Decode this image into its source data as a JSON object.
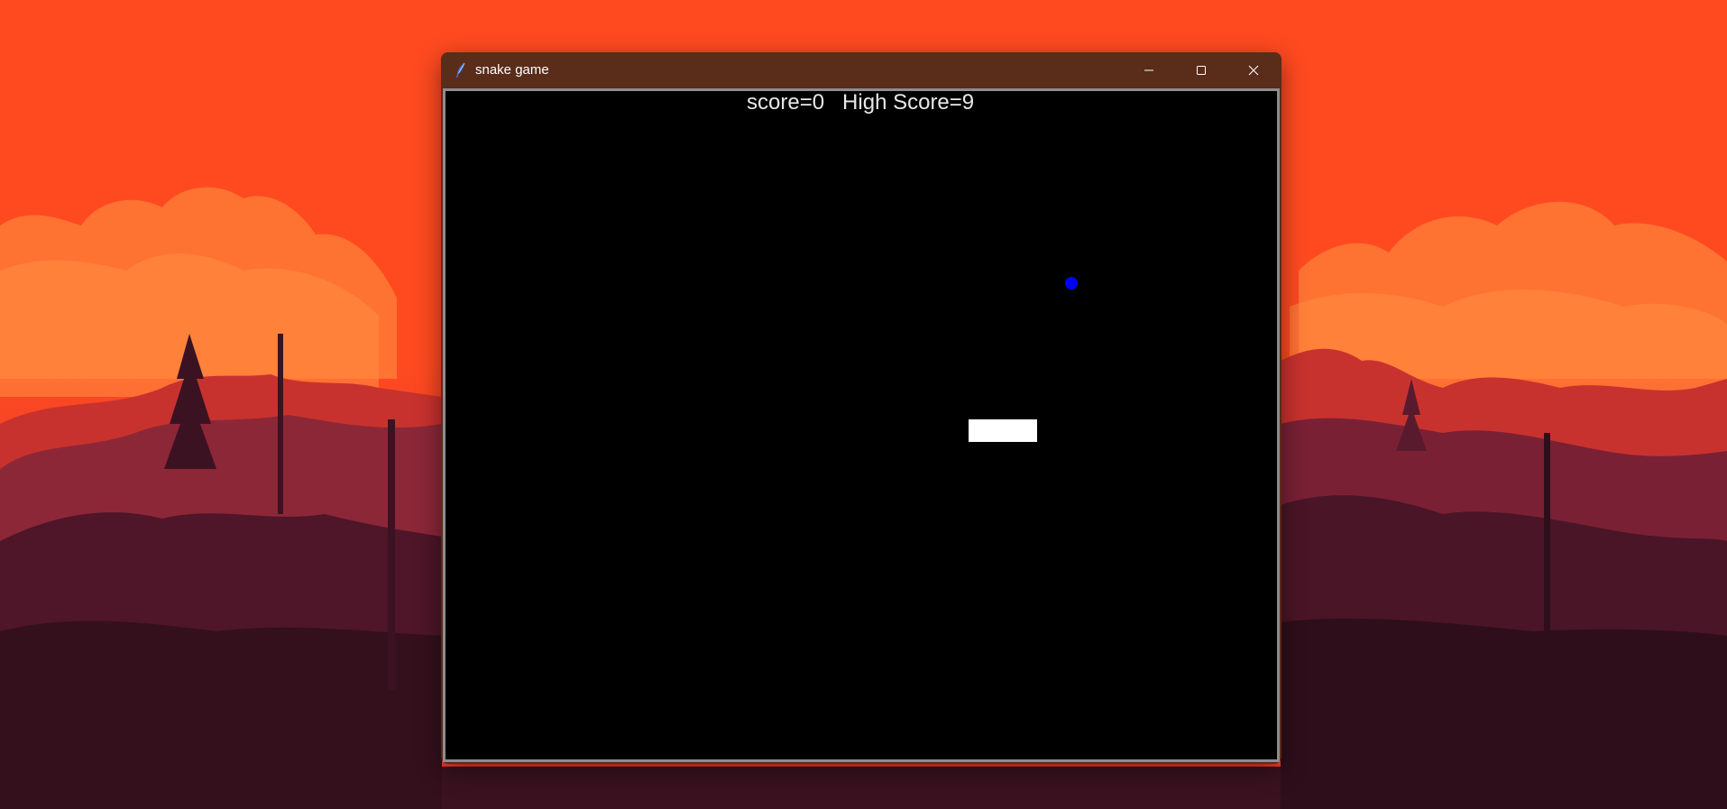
{
  "window": {
    "title": "snake game",
    "app_icon": "feather-icon",
    "controls": {
      "minimize_icon": "minimize-icon",
      "maximize_icon": "maximize-icon",
      "close_icon": "close-icon"
    }
  },
  "game": {
    "score_label": "score=0   High Score=9",
    "score": 0,
    "high_score": 9,
    "colors": {
      "background": "#000000",
      "text": "#e8e8e8",
      "snake": "#ffffff",
      "food": "#0000ff"
    },
    "snake_segments": 3
  },
  "desktop": {
    "wallpaper": "sunset-forest-landscape"
  }
}
